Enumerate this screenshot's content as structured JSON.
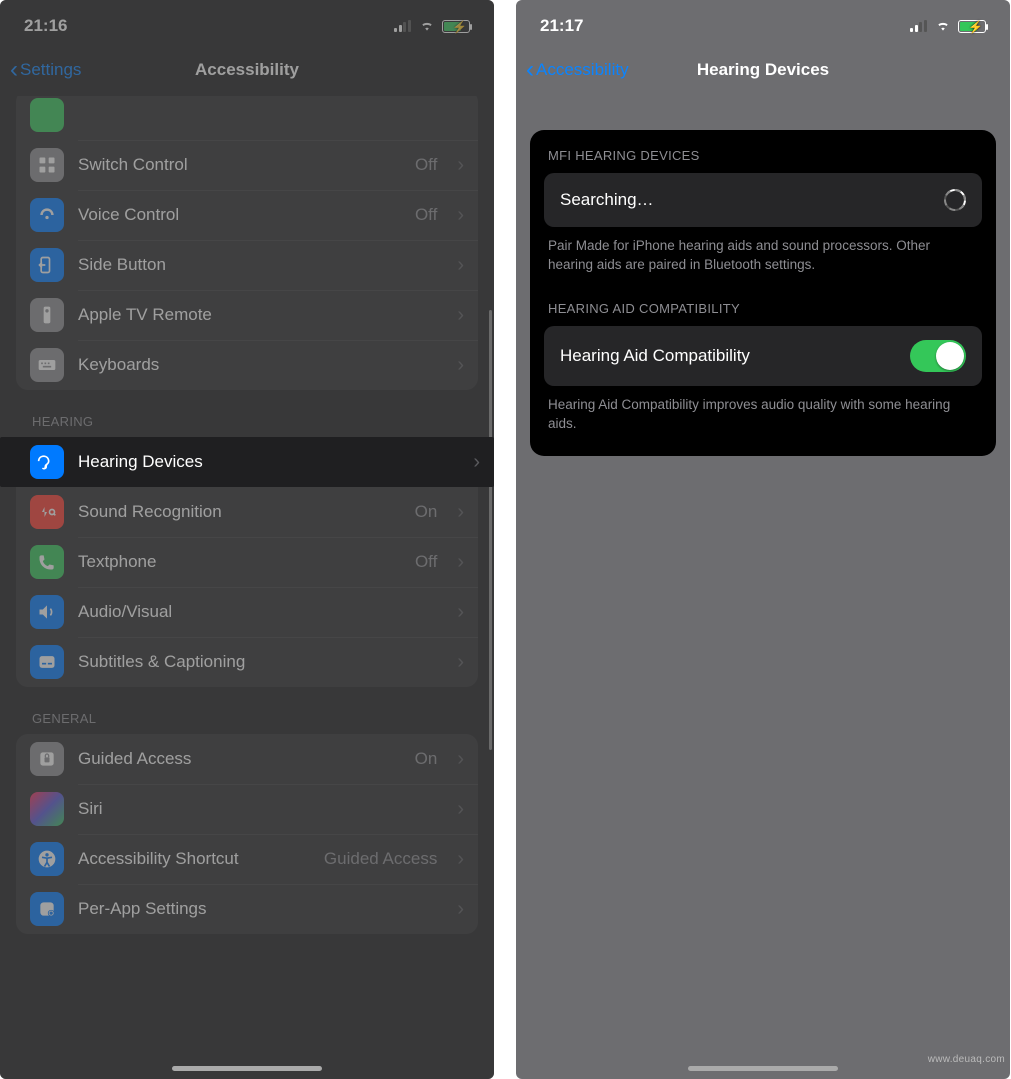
{
  "left": {
    "time": "21:16",
    "back": "Settings",
    "title": "Accessibility",
    "rows_top": [
      {
        "label": "",
        "value": ""
      },
      {
        "label": "Switch Control",
        "value": "Off"
      },
      {
        "label": "Voice Control",
        "value": "Off"
      },
      {
        "label": "Side Button",
        "value": ""
      },
      {
        "label": "Apple TV Remote",
        "value": ""
      },
      {
        "label": "Keyboards",
        "value": ""
      }
    ],
    "hearing_header": "HEARING",
    "hearing_rows": [
      {
        "label": "Hearing Devices",
        "value": ""
      },
      {
        "label": "Sound Recognition",
        "value": "On"
      },
      {
        "label": "Textphone",
        "value": "Off"
      },
      {
        "label": "Audio/Visual",
        "value": ""
      },
      {
        "label": "Subtitles & Captioning",
        "value": ""
      }
    ],
    "general_header": "GENERAL",
    "general_rows": [
      {
        "label": "Guided Access",
        "value": "On"
      },
      {
        "label": "Siri",
        "value": ""
      },
      {
        "label": "Accessibility Shortcut",
        "value": "Guided Access"
      },
      {
        "label": "Per-App Settings",
        "value": ""
      }
    ]
  },
  "right": {
    "time": "21:17",
    "back": "Accessibility",
    "title": "Hearing Devices",
    "mfi_header": "MFI HEARING DEVICES",
    "searching": "Searching…",
    "mfi_footer": "Pair Made for iPhone hearing aids and sound processors. Other hearing aids are paired in Bluetooth settings.",
    "hac_header": "HEARING AID COMPATIBILITY",
    "hac_label": "Hearing Aid Compatibility",
    "hac_on": true,
    "hac_footer": "Hearing Aid Compatibility improves audio quality with some hearing aids."
  },
  "watermark": "www.deuaq.com"
}
